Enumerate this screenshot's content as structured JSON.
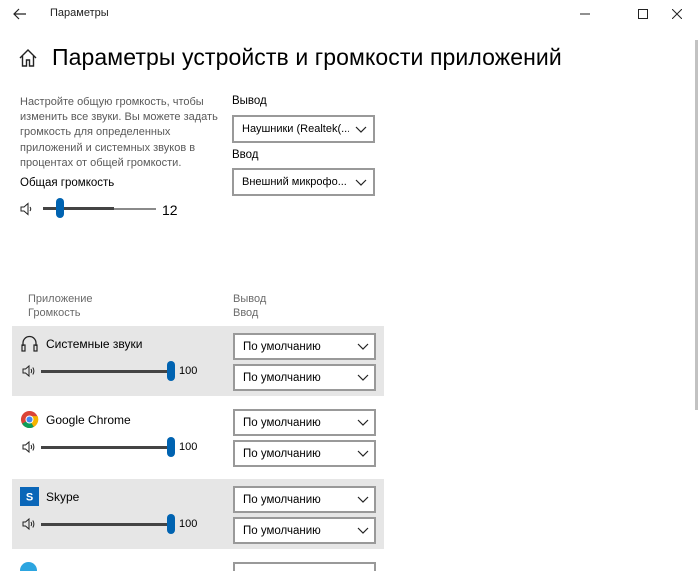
{
  "window": {
    "title": "Параметры",
    "back_icon": "back-arrow-icon",
    "minimize_icon": "minimize-icon",
    "maximize_icon": "maximize-icon",
    "close_icon": "close-icon"
  },
  "header": {
    "title": "Параметры устройств и громкости приложений",
    "home_icon": "home-icon"
  },
  "master": {
    "description": "Настройте общую громкость, чтобы изменить все звуки. Вы можете задать громкость для определенных приложений и системных звуков в процентах от общей громкости.",
    "volume_label": "Общая громкость",
    "volume_value": "12",
    "volume_level_percent": 12
  },
  "output": {
    "label": "Вывод",
    "selected": "Наушники (Realtek(..."
  },
  "input": {
    "label": "Ввод",
    "selected": "Внешний микрофо..."
  },
  "table": {
    "col_app": "Приложение",
    "col_volume": "Громкость",
    "col_output": "Вывод",
    "col_input": "Ввод"
  },
  "apps": [
    {
      "name": "Системные звуки",
      "icon": "headphones-icon",
      "volume": "100",
      "output": "По умолчанию",
      "input": "По умолчанию",
      "shaded": true
    },
    {
      "name": "Google Chrome",
      "icon": "chrome-icon",
      "volume": "100",
      "output": "По умолчанию",
      "input": "По умолчанию",
      "shaded": false
    },
    {
      "name": "Skype",
      "icon": "skype-icon",
      "volume": "100",
      "output": "По умолчанию",
      "input": "По умолчанию",
      "shaded": true
    }
  ],
  "colors": {
    "accent": "#0063b1",
    "row_shade": "#e6e6e6"
  }
}
